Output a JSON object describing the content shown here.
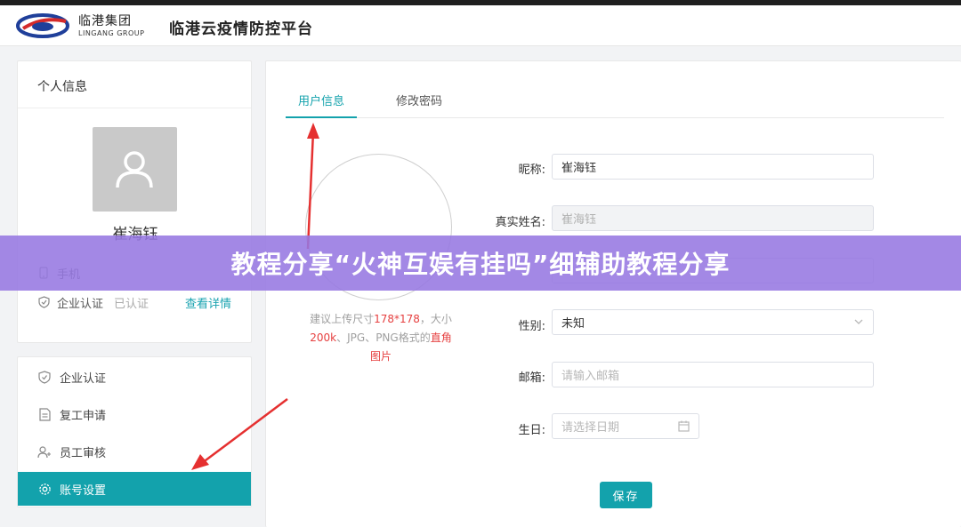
{
  "header": {
    "logo_cn": "临港集团",
    "logo_en": "LINGANG GROUP",
    "app_title": "临港云疫情防控平台"
  },
  "profile": {
    "title": "个人信息",
    "name": "崔海钰",
    "phone_label": "手机",
    "enterprise_label": "企业认证",
    "enterprise_status": "已认证",
    "detail_link": "查看详情"
  },
  "menu": {
    "items": [
      {
        "label": "企业认证",
        "icon": "shield-check-icon"
      },
      {
        "label": "复工申请",
        "icon": "document-icon"
      },
      {
        "label": "员工审核",
        "icon": "users-icon"
      },
      {
        "label": "账号设置",
        "icon": "gear-icon",
        "active": true
      }
    ]
  },
  "tabs": [
    {
      "label": "用户信息",
      "active": true
    },
    {
      "label": "修改密码",
      "active": false
    }
  ],
  "upload": {
    "hint_a": "建议上传尺寸",
    "hint_size": "178*178",
    "hint_b": "，大小",
    "hint_limit": "200k",
    "hint_c": "、JPG、PNG格式的",
    "hint_d": "直角",
    "hint_e": "图片"
  },
  "form": {
    "nickname_label": "昵称:",
    "nickname_value": "崔海钰",
    "realname_label": "真实姓名:",
    "realname_value": "崔海钰",
    "gender_label": "性别:",
    "gender_value": "未知",
    "email_label": "邮箱:",
    "email_placeholder": "请输入邮箱",
    "birthday_label": "生日:",
    "birthday_placeholder": "请选择日期",
    "save_label": "保存"
  },
  "banner": {
    "text": "教程分享“火神互娱有挂吗”细辅助教程分享"
  },
  "colors": {
    "accent": "#13a2ac",
    "banner": "#9678e1",
    "annotation_red": "#e53030"
  }
}
